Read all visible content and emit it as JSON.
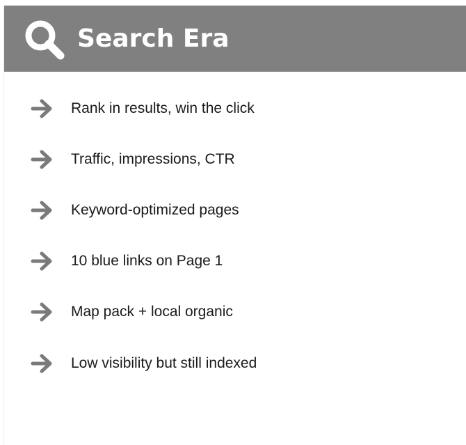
{
  "header": {
    "title": "Search Era",
    "icon": "search-icon",
    "background": "#808080",
    "title_color": "#ffffff"
  },
  "items": [
    {
      "icon": "arrow-right-icon",
      "label": "Rank in results, win the click"
    },
    {
      "icon": "arrow-right-icon",
      "label": "Traffic, impressions, CTR"
    },
    {
      "icon": "arrow-right-icon",
      "label": "Keyword-optimized pages"
    },
    {
      "icon": "arrow-right-icon",
      "label": "10 blue links on Page 1"
    },
    {
      "icon": "arrow-right-icon",
      "label": "Map pack + local organic"
    },
    {
      "icon": "arrow-right-icon",
      "label": "Low visibility but still indexed"
    }
  ],
  "colors": {
    "arrow": "#7a7a7a",
    "text": "#1a1a1a"
  }
}
